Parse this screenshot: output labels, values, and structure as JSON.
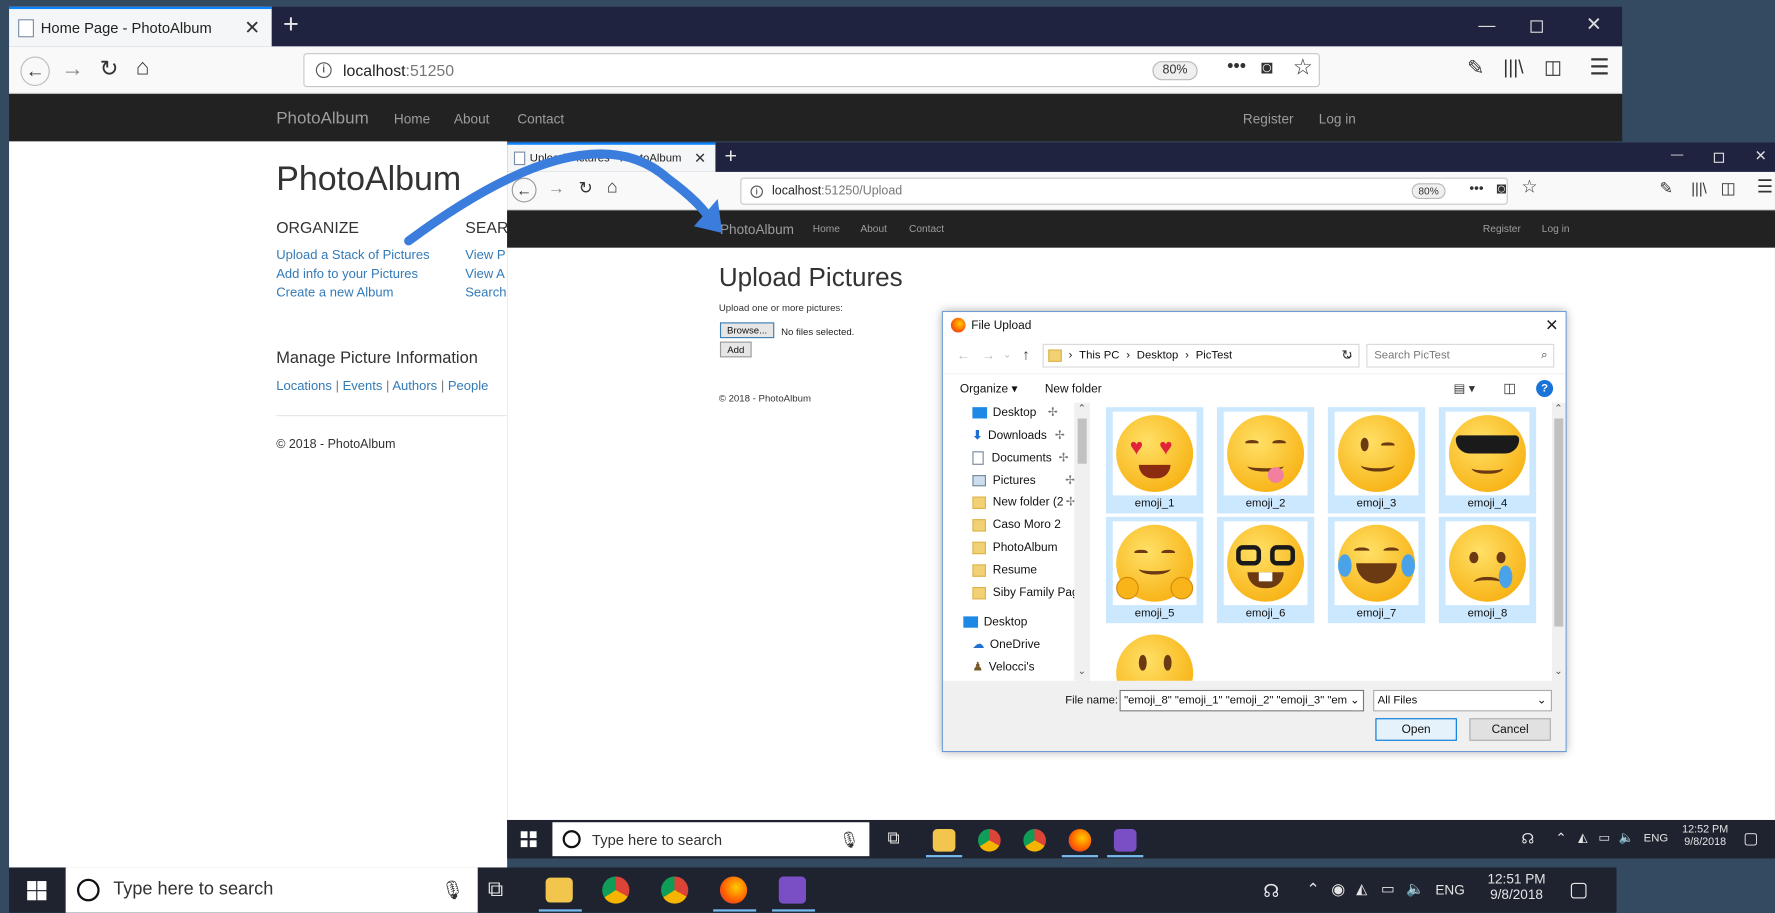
{
  "browser1": {
    "tab_title": "Home Page - PhotoAlbum",
    "url_host": "localhost",
    "url_port": ":51250",
    "zoom": "80%",
    "site": {
      "brand": "PhotoAlbum",
      "nav": [
        "Home",
        "About",
        "Contact"
      ],
      "right_nav": [
        "Register",
        "Log in"
      ],
      "heading": "PhotoAlbum",
      "organize_heading": "ORGANIZE",
      "search_heading": "SEAR",
      "organize_links": [
        "Upload a Stack of Pictures",
        "Add info to your Pictures",
        "Create a new Album"
      ],
      "search_links": [
        "View P",
        "View A",
        "Search"
      ],
      "manage_heading": "Manage Picture Information",
      "manage_links": [
        "Locations",
        "Events",
        "Authors",
        "People"
      ],
      "separator": "|",
      "footer": "© 2018 - PhotoAlbum"
    }
  },
  "browser2": {
    "tab_title": "Upload Pictures - PhotoAlbum",
    "url_host": "localhost",
    "url_rest": ":51250/Upload",
    "zoom": "80%",
    "site": {
      "brand": "PhotoAlbum",
      "nav": [
        "Home",
        "About",
        "Contact"
      ],
      "right_nav": [
        "Register",
        "Log in"
      ],
      "heading": "Upload Pictures",
      "instruction": "Upload one or more pictures:",
      "browse_label": "Browse...",
      "no_files": "No files selected.",
      "add_label": "Add",
      "footer": "© 2018 - PhotoAlbum"
    }
  },
  "dialog": {
    "title": "File Upload",
    "breadcrumb": [
      "This PC",
      "Desktop",
      "PicTest"
    ],
    "search_placeholder": "Search PicTest",
    "organize_label": "Organize",
    "new_folder_label": "New folder",
    "tree_quick": [
      "Desktop",
      "Downloads",
      "Documents",
      "Pictures",
      "New folder (2",
      "Caso Moro 2",
      "PhotoAlbum",
      "Resume",
      "Siby Family Page"
    ],
    "tree_root": [
      "Desktop",
      "OneDrive",
      "Velocci's"
    ],
    "files": [
      "emoji_1",
      "emoji_2",
      "emoji_3",
      "emoji_4",
      "emoji_5",
      "emoji_6",
      "emoji_7",
      "emoji_8"
    ],
    "filename_label": "File name:",
    "filename_value": "\"emoji_8\" \"emoji_1\" \"emoji_2\" \"emoji_3\" \"em",
    "filetype_value": "All Files",
    "open_label": "Open",
    "cancel_label": "Cancel"
  },
  "taskbar_inner": {
    "search_placeholder": "Type here to search",
    "lang": "ENG",
    "time": "12:52 PM",
    "date": "9/8/2018"
  },
  "taskbar_outer": {
    "search_placeholder": "Type here to search",
    "lang": "ENG",
    "time": "12:51 PM",
    "date": "9/8/2018"
  },
  "colors": {
    "accent_blue": "#3b7ddd",
    "link": "#337ab7",
    "navbar": "#222222",
    "selection": "#cce8ff"
  }
}
